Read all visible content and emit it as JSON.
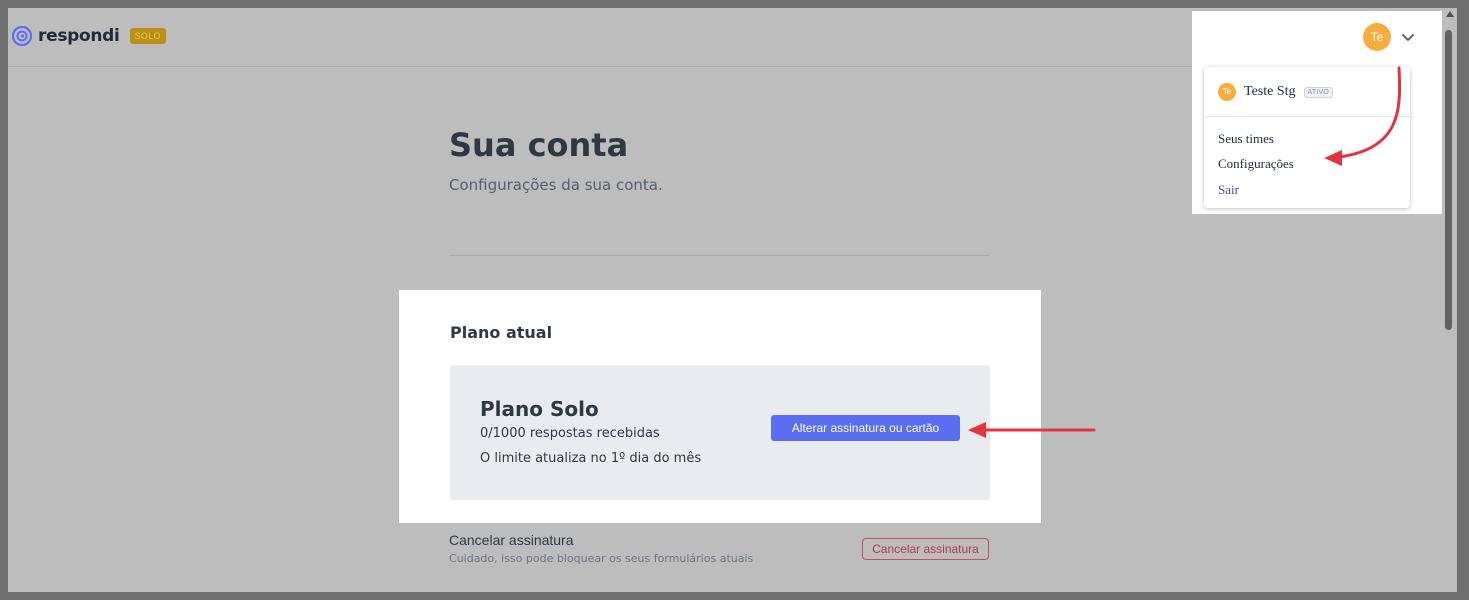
{
  "brand": {
    "name": "respondi",
    "plan_badge": "SOLO",
    "accent": "#5b6df1"
  },
  "header": {
    "avatar_initials": "Te"
  },
  "page": {
    "title": "Sua conta",
    "subtitle": "Configurações da sua conta."
  },
  "plan": {
    "heading": "Plano atual",
    "name": "Plano Solo",
    "usage": "0/1000 respostas recebidas",
    "limit_note": "O limite atualiza no 1º dia do mês",
    "change_button": "Alterar assinatura ou cartão"
  },
  "cancel": {
    "title": "Cancelar assinatura",
    "description": "Cuidado, isso pode bloquear os seus formulários atuais",
    "button": "Cancelar assinatura",
    "color": "#c44f64"
  },
  "user_menu": {
    "user_name": "Teste Stg",
    "avatar_initials": "Te",
    "status": "ATIVO",
    "items": [
      "Seus times",
      "Configurações",
      "Sair"
    ]
  },
  "annotation_color": "#e0353f"
}
